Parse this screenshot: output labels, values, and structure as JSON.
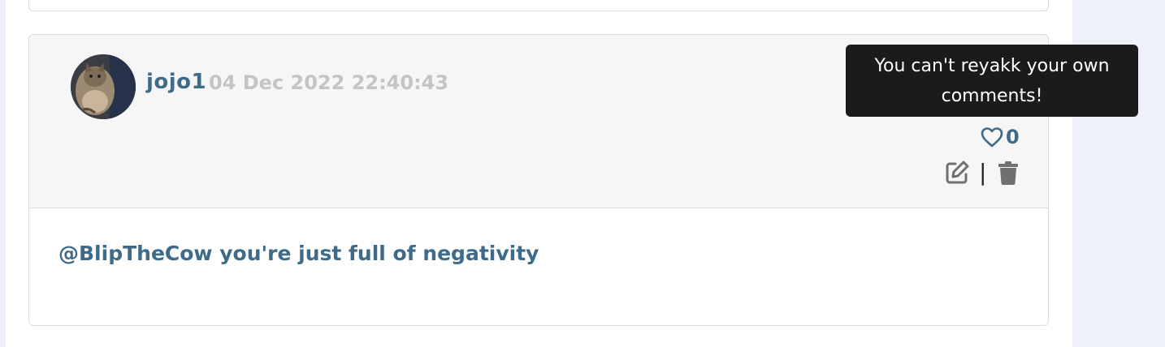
{
  "comment": {
    "author": "jojo1",
    "timestamp": "04 Dec 2022 22:40:43",
    "likes": "0",
    "separator": "|",
    "body": "@BlipTheCow you're just full of negativity"
  },
  "tooltip": {
    "text": "You can't reyakk your own comments!"
  },
  "icons": {
    "like": "heart-outline-icon",
    "edit": "edit-icon",
    "delete": "trash-icon"
  },
  "colors": {
    "accent": "#3e6b8a",
    "timestamp": "#c4c4c4",
    "header_bg": "#f6f6f6",
    "tooltip_bg": "#1b1b1b",
    "icon_gray": "#707070"
  }
}
